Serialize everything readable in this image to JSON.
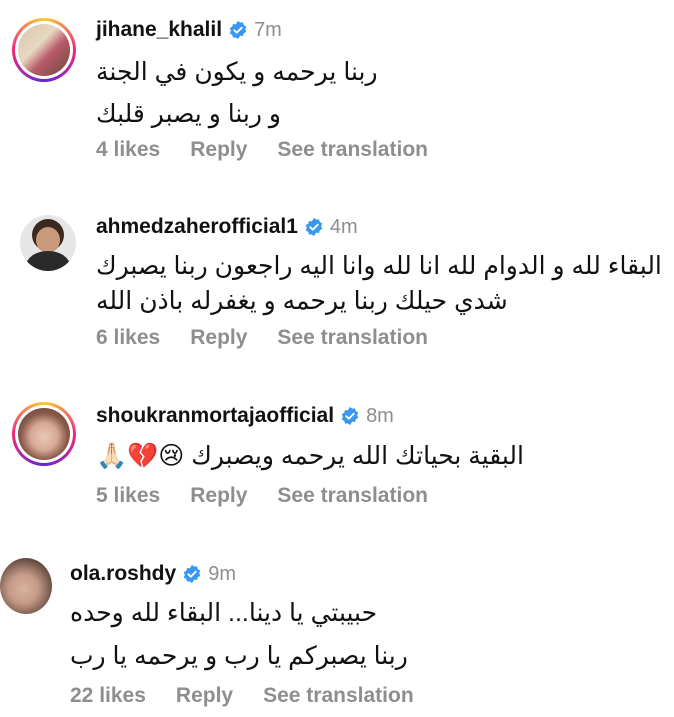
{
  "labels": {
    "reply": "Reply",
    "see_translation": "See translation"
  },
  "colors": {
    "verified": "#3897f0",
    "muted": "#8e8e8e"
  },
  "comments": [
    {
      "username": "jihane_khalil",
      "time": "7m",
      "lines": [
        "ربنا يرحمه و يكون في الجنة",
        "و ربنا و يصبر قلبك"
      ],
      "likes": "4 likes"
    },
    {
      "username": "ahmedzaherofficial1",
      "time": "4m",
      "lines": [
        "البقاء لله و الدوام لله انا لله وانا اليه راجعون ربنا يصبرك",
        "شدي حيلك ربنا يرحمه و يغفرله باذن الله"
      ],
      "likes": "6 likes"
    },
    {
      "username": "shoukranmortajaofficial",
      "time": "8m",
      "lines": [
        "البقية بحياتك الله يرحمه ويصبرك 😢💔🙏🏻"
      ],
      "likes": "5 likes"
    },
    {
      "username": "ola.roshdy",
      "time": "9m",
      "lines": [
        "حبيبتي يا دينا... البقاء لله وحده",
        "ربنا يصبركم يا رب و يرحمه يا رب"
      ],
      "likes": "22 likes"
    }
  ]
}
